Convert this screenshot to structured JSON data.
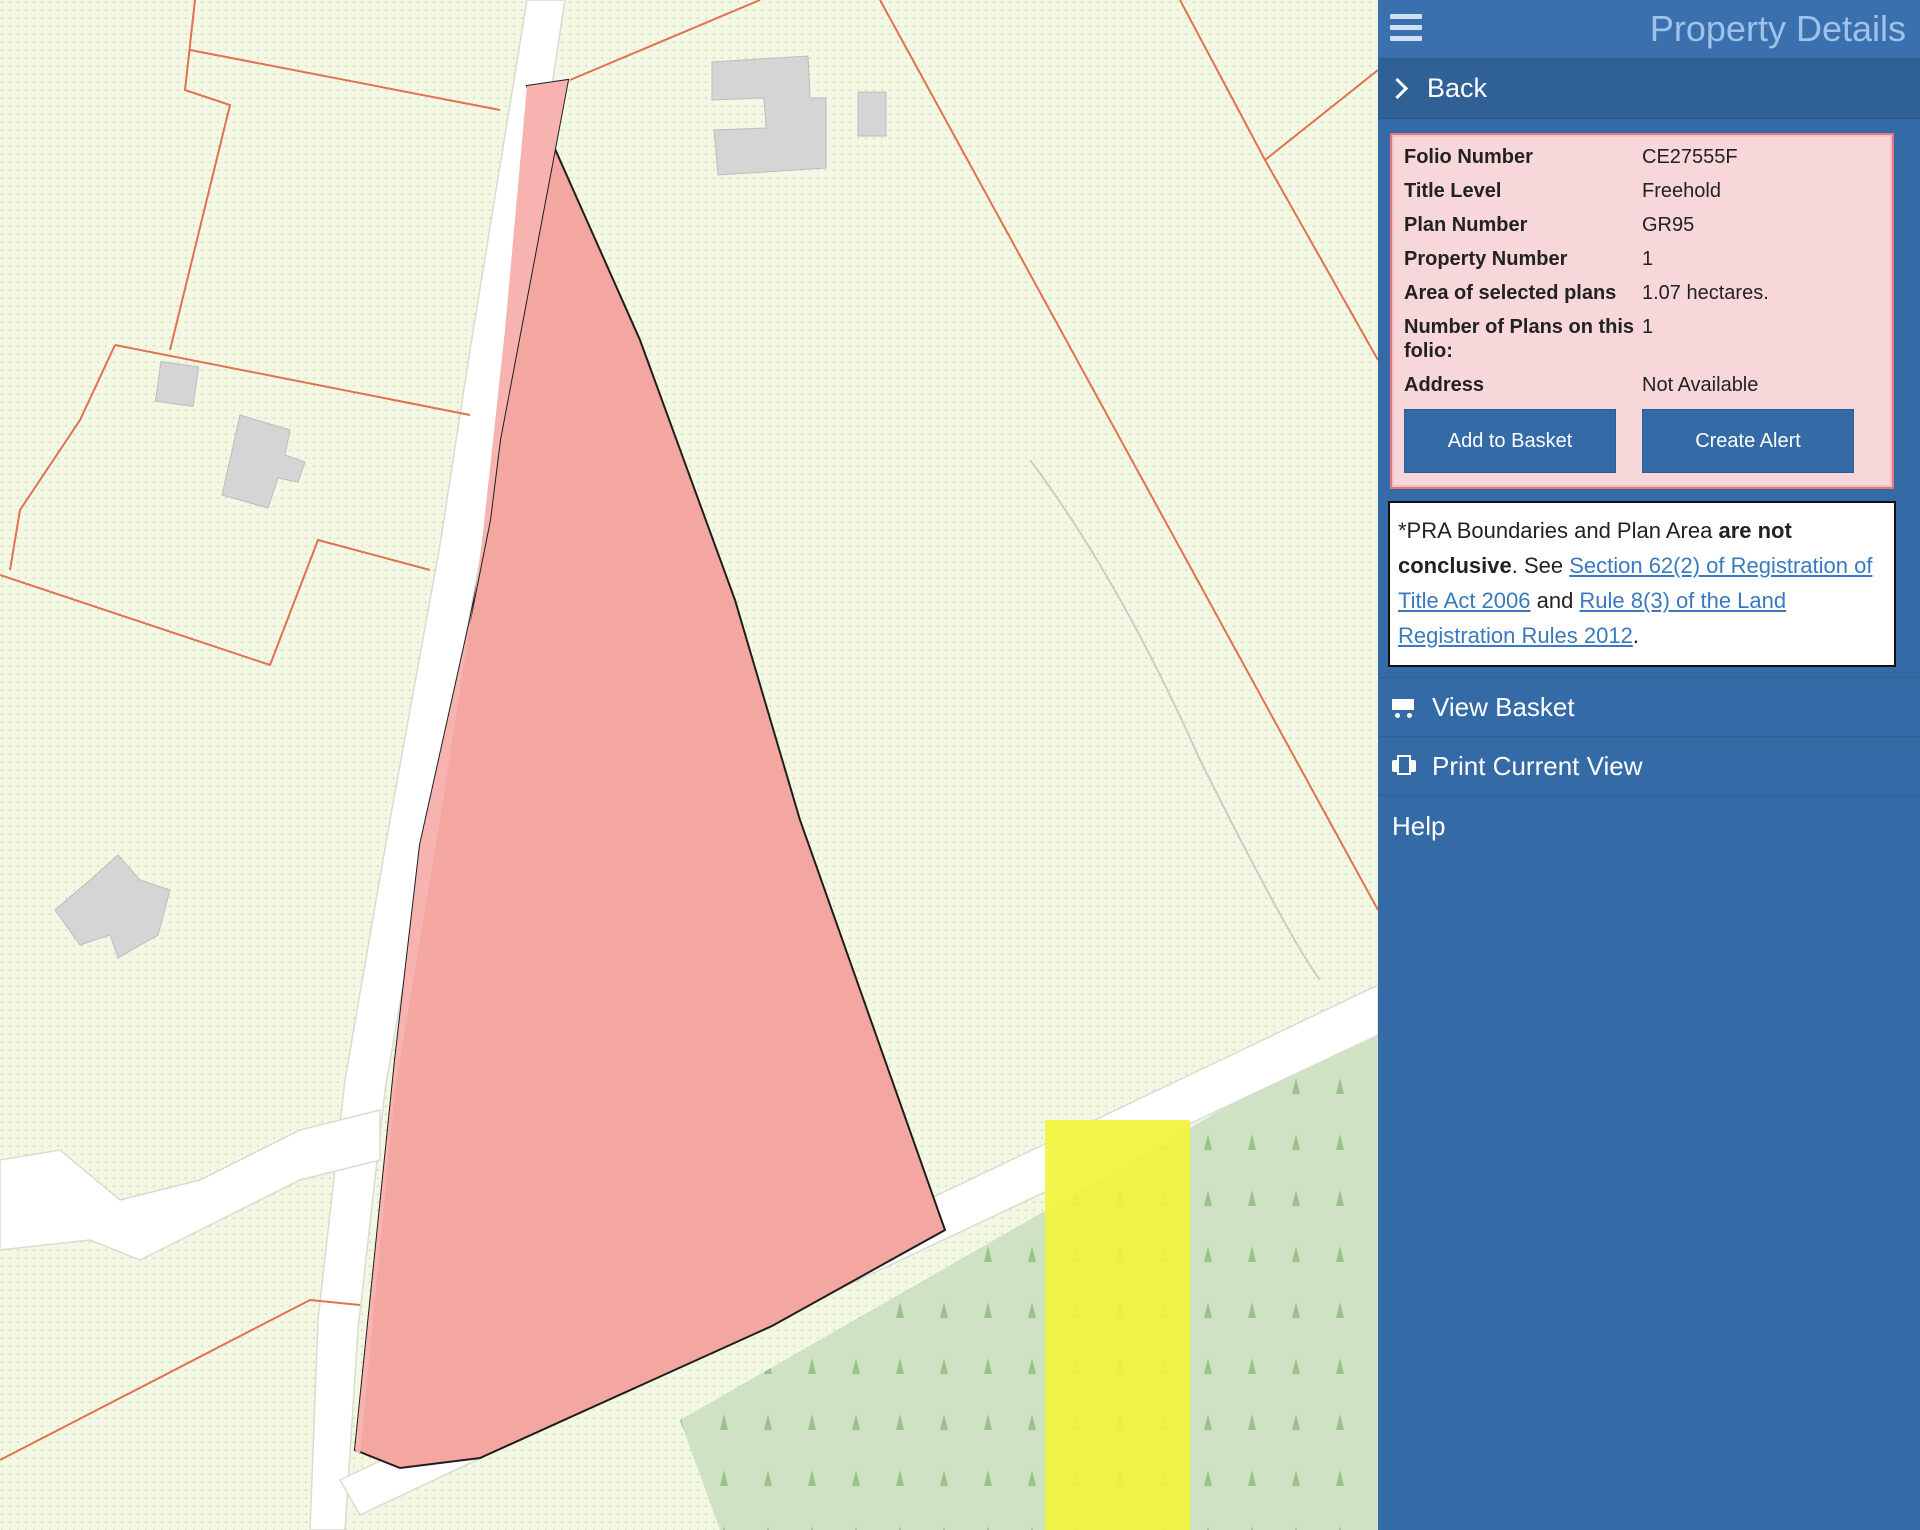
{
  "header": {
    "title": "Property Details",
    "menu_icon": "hamburger-menu-icon"
  },
  "back": {
    "label": "Back"
  },
  "property": {
    "rows": [
      {
        "label": "Folio Number",
        "value": "CE27555F"
      },
      {
        "label": "Title Level",
        "value": "Freehold"
      },
      {
        "label": "Plan Number",
        "value": "GR95"
      },
      {
        "label": "Property Number",
        "value": "1"
      },
      {
        "label": "Area of selected plans",
        "value": "1.07 hectares."
      },
      {
        "label": "Number of Plans on this folio:",
        "value": "1"
      },
      {
        "label": "Address",
        "value": "Not Available"
      }
    ],
    "add_to_basket": "Add to Basket",
    "create_alert": "Create Alert"
  },
  "notice": {
    "t1": "*PRA Boundaries and Plan Area ",
    "bold": "are not conclusive",
    "t2": ". See ",
    "link1": "Section 62(2) of Registration of Title Act 2006",
    "t3": " and ",
    "link2": "Rule 8(3) of the Land Registration Rules 2012",
    "t4": "."
  },
  "nav": {
    "view_basket": "View Basket",
    "print_view": "Print Current View",
    "help": "Help"
  },
  "colors": {
    "panel": "#346aa6",
    "selected_plot": "#f4a7a0",
    "highlight": "#f2f53a",
    "forest": "#cfe2c4",
    "boundary": "#e2714f"
  }
}
